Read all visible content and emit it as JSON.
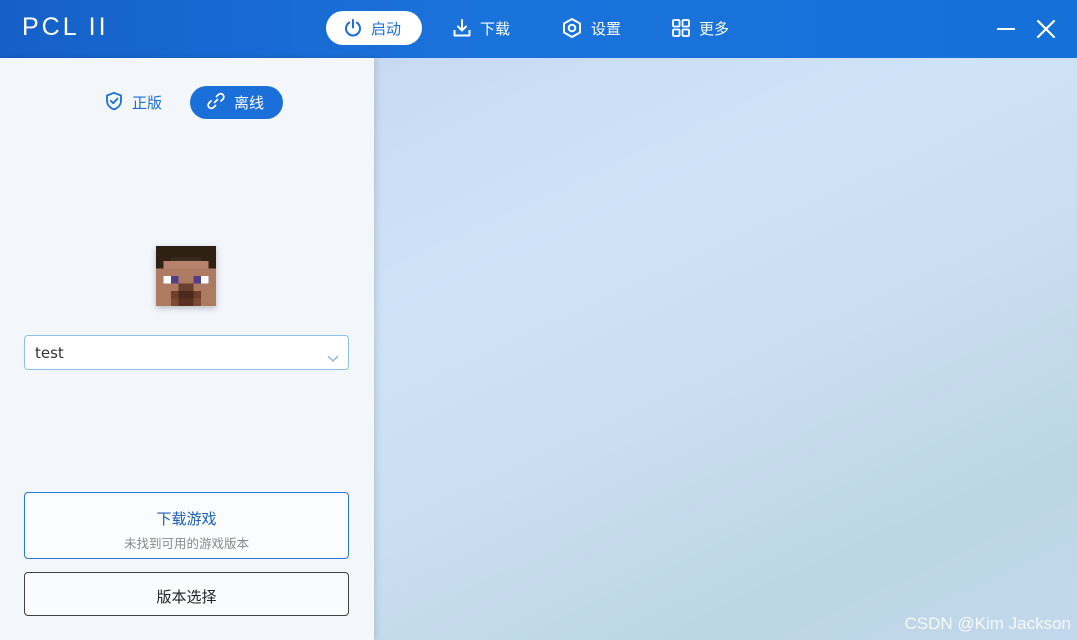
{
  "app": {
    "title": "PCL II"
  },
  "nav": {
    "launch": "启动",
    "download": "下载",
    "settings": "设置",
    "more": "更多"
  },
  "login_tabs": {
    "official": "正版",
    "offline": "离线",
    "active": "offline"
  },
  "account": {
    "username": "test"
  },
  "actions": {
    "download_game_title": "下载游戏",
    "download_game_subtitle": "未找到可用的游戏版本",
    "version_select": "版本选择"
  },
  "watermark": "CSDN @Kim Jackson",
  "colors": {
    "accent": "#1a6fd8",
    "titlebar": "#1a6cd6",
    "panel_bg": "#f3f6fb"
  },
  "icons": {
    "launch": "power-icon",
    "download": "download-icon",
    "settings": "gear-icon",
    "more": "grid-icon",
    "official": "shield-icon",
    "offline": "link-icon"
  }
}
